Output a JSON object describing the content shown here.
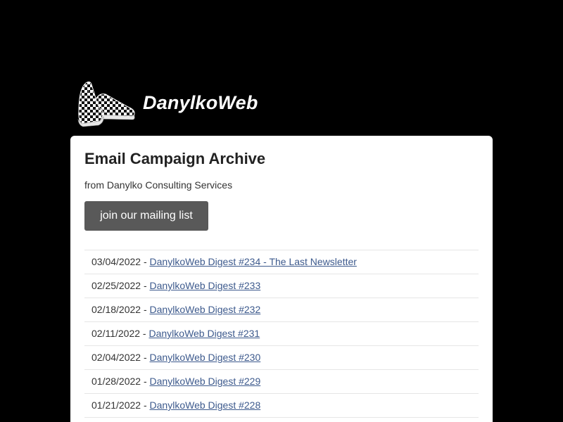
{
  "header": {
    "brand": "DanylkoWeb",
    "logo_icon": "checkered-slip-on-shoes-icon"
  },
  "main": {
    "title": "Email Campaign Archive",
    "subtitle": "from Danylko Consulting Services",
    "join_button": "join our mailing list"
  },
  "campaigns": [
    {
      "date": "03/04/2022",
      "separator": " - ",
      "title": "DanylkoWeb Digest #234 - The Last Newsletter"
    },
    {
      "date": "02/25/2022",
      "separator": " - ",
      "title": "DanylkoWeb Digest #233"
    },
    {
      "date": "02/18/2022",
      "separator": " - ",
      "title": "DanylkoWeb Digest #232"
    },
    {
      "date": "02/11/2022",
      "separator": " - ",
      "title": "DanylkoWeb Digest #231"
    },
    {
      "date": "02/04/2022",
      "separator": " - ",
      "title": "DanylkoWeb Digest #230"
    },
    {
      "date": "01/28/2022",
      "separator": " - ",
      "title": "DanylkoWeb Digest #229"
    },
    {
      "date": "01/21/2022",
      "separator": " - ",
      "title": "DanylkoWeb Digest #228"
    }
  ],
  "colors": {
    "page_background": "#000000",
    "card_background": "#ffffff",
    "button_background": "#595959",
    "link": "#3d5a8d"
  }
}
